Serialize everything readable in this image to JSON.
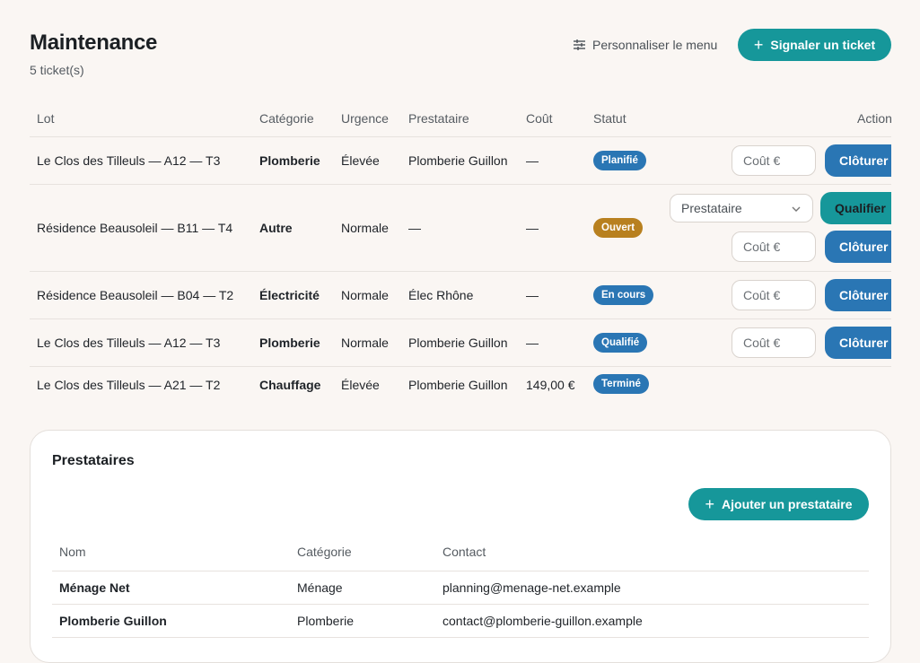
{
  "header": {
    "title": "Maintenance",
    "subtitle": "5 ticket(s)",
    "customize_label": "Personnaliser le menu",
    "report_label": "Signaler un ticket"
  },
  "tickets": {
    "columns": [
      "Lot",
      "Catégorie",
      "Urgence",
      "Prestataire",
      "Coût",
      "Statut",
      "Actions"
    ],
    "rows": [
      {
        "lot": "Le Clos des Tilleuls — A12 — T3",
        "category": "Plomberie",
        "urgency": "Élevée",
        "provider": "Plomberie Guillon",
        "cost": "—",
        "status": "Planifié",
        "status_color": "#2a76b4"
      },
      {
        "lot": "Résidence Beausoleil — B11 — T4",
        "category": "Autre",
        "urgency": "Normale",
        "provider": "—",
        "cost": "—",
        "status": "Ouvert",
        "status_color": "#b8801f"
      },
      {
        "lot": "Résidence Beausoleil — B04 — T2",
        "category": "Électricité",
        "urgency": "Normale",
        "provider": "Élec Rhône",
        "cost": "—",
        "status": "En cours",
        "status_color": "#2a76b4"
      },
      {
        "lot": "Le Clos des Tilleuls — A12 — T3",
        "category": "Plomberie",
        "urgency": "Normale",
        "provider": "Plomberie Guillon",
        "cost": "—",
        "status": "Qualifié",
        "status_color": "#2a76b4"
      },
      {
        "lot": "Le Clos des Tilleuls — A21 — T2",
        "category": "Chauffage",
        "urgency": "Élevée",
        "provider": "Plomberie Guillon",
        "cost": "149,00 €",
        "status": "Terminé",
        "status_color": "#2a76b4"
      }
    ],
    "cost_placeholder": "Coût €",
    "close_label": "Clôturer",
    "qualify_label": "Qualifier",
    "provider_select_value": "Prestataire"
  },
  "providers": {
    "title": "Prestataires",
    "add_label": "Ajouter un prestataire",
    "columns": [
      "Nom",
      "Catégorie",
      "Contact"
    ],
    "rows": [
      {
        "name": "Ménage Net",
        "category": "Ménage",
        "contact": "planning@menage-net.example"
      },
      {
        "name": "Plomberie Guillon",
        "category": "Plomberie",
        "contact": "contact@plomberie-guillon.example"
      }
    ]
  },
  "colors": {
    "accent": "#16979a",
    "primary_blue": "#2a76b4",
    "open_badge": "#b8801f",
    "background": "#faf6f3"
  }
}
